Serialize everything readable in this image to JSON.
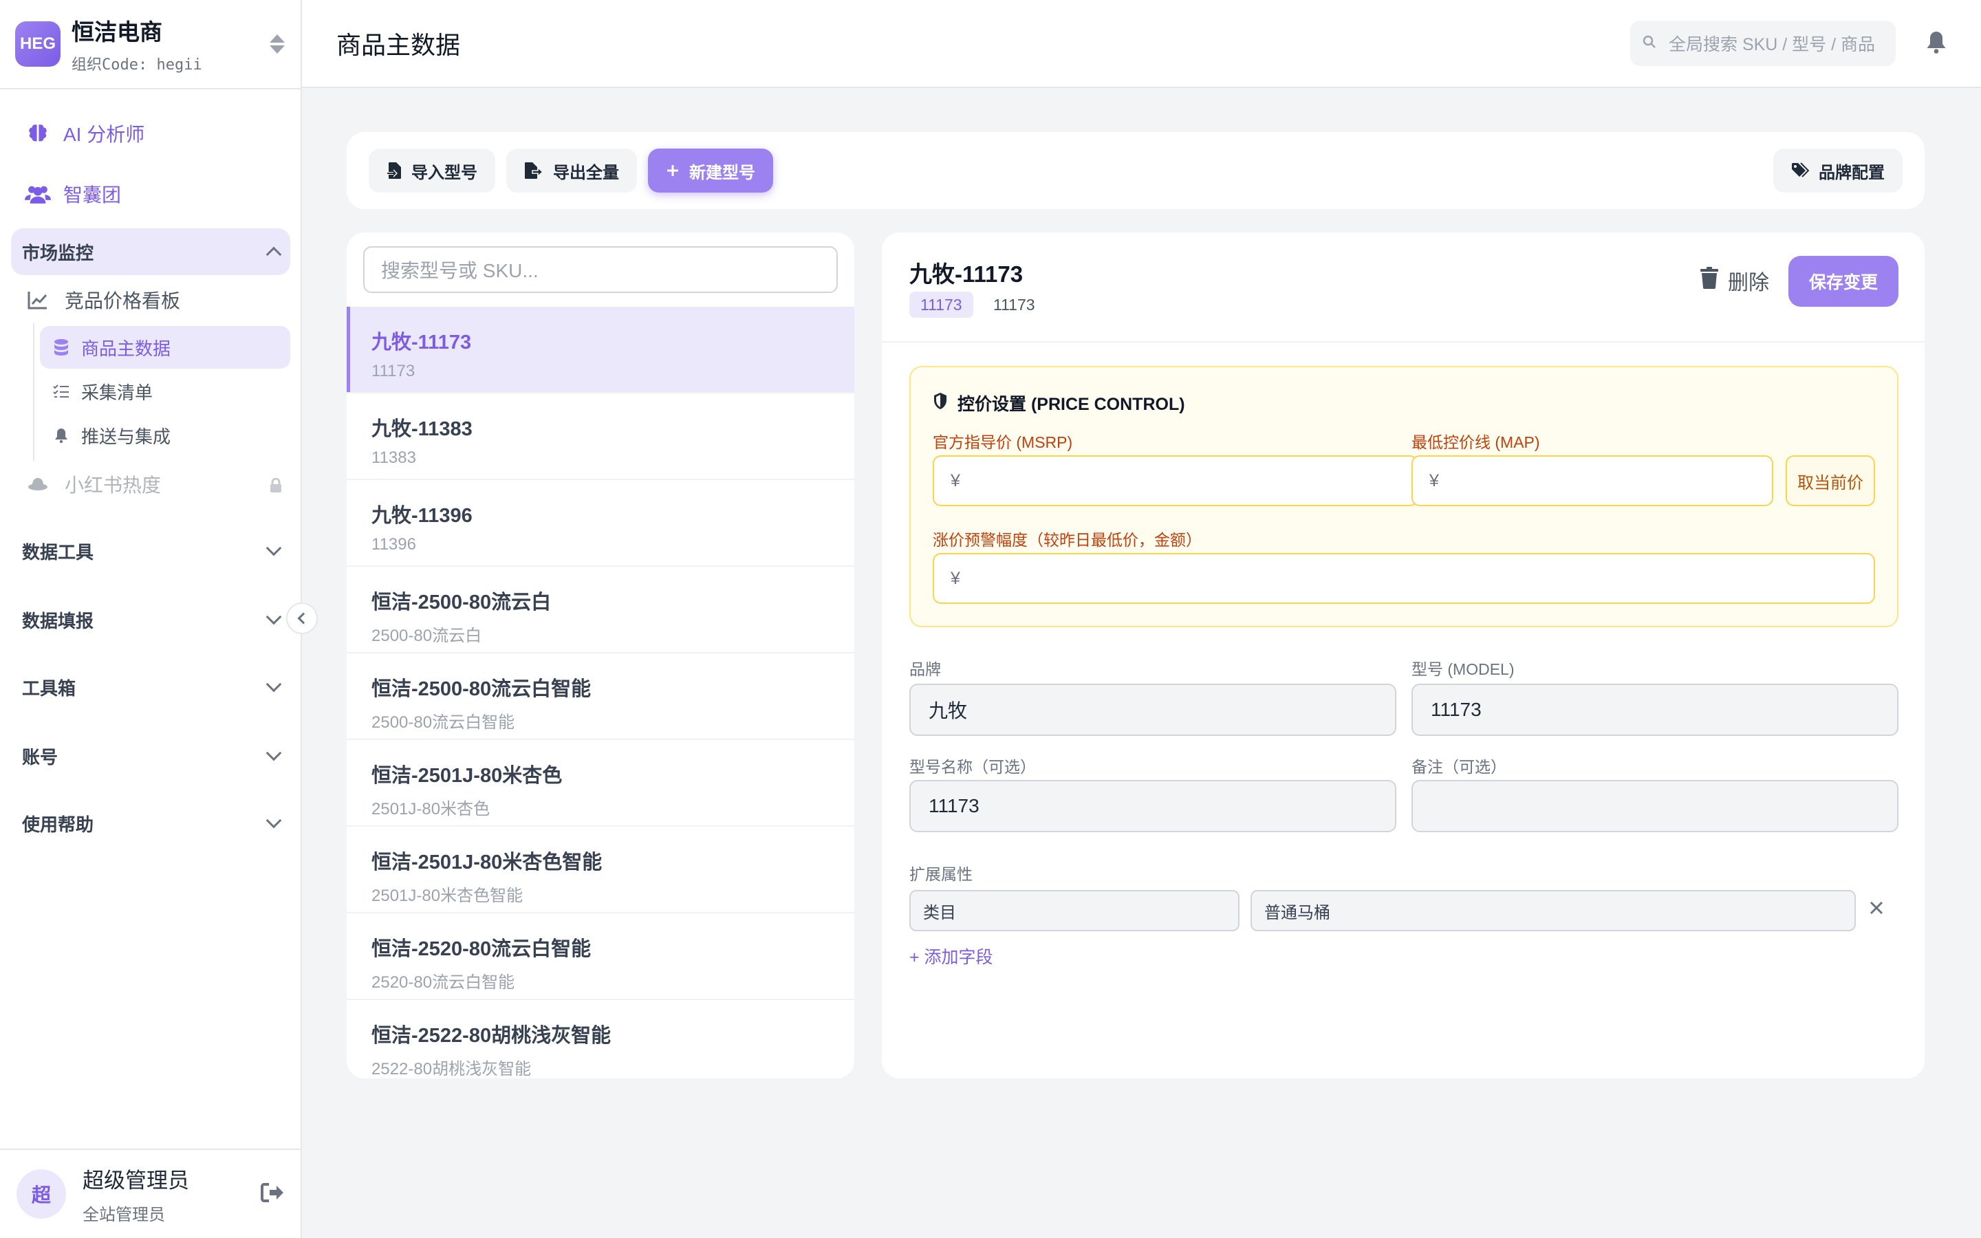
{
  "org": {
    "logo_text": "HEG",
    "name": "恒洁电商",
    "code": "组织Code: hegii"
  },
  "nav": {
    "ai_analyst": "AI 分析师",
    "think_tank": "智囊团",
    "market_group": "市场监控",
    "price_board": "竞品价格看板",
    "product_master": "商品主数据",
    "collect_list": "采集清单",
    "push_integration": "推送与集成",
    "xhs_heat": "小红书热度",
    "groups": [
      "数据工具",
      "数据填报",
      "工具箱",
      "账号",
      "使用帮助"
    ]
  },
  "user": {
    "avatar_text": "超",
    "name": "超级管理员",
    "role": "全站管理员"
  },
  "header": {
    "title": "商品主数据",
    "search_placeholder": "全局搜索 SKU / 型号 / 商品"
  },
  "toolbar": {
    "import": "导入型号",
    "export": "导出全量",
    "new_model": "新建型号",
    "brand_config": "品牌配置"
  },
  "list": {
    "search_placeholder": "搜索型号或 SKU...",
    "items": [
      {
        "name": "九牧-11173",
        "sku": "11173"
      },
      {
        "name": "九牧-11383",
        "sku": "11383"
      },
      {
        "name": "九牧-11396",
        "sku": "11396"
      },
      {
        "name": "恒洁-2500-80流云白",
        "sku": "2500-80流云白"
      },
      {
        "name": "恒洁-2500-80流云白智能",
        "sku": "2500-80流云白智能"
      },
      {
        "name": "恒洁-2501J-80米杏色",
        "sku": "2501J-80米杏色"
      },
      {
        "name": "恒洁-2501J-80米杏色智能",
        "sku": "2501J-80米杏色智能"
      },
      {
        "name": "恒洁-2520-80流云白智能",
        "sku": "2520-80流云白智能"
      },
      {
        "name": "恒洁-2522-80胡桃浅灰智能",
        "sku": "2522-80胡桃浅灰智能"
      }
    ]
  },
  "detail": {
    "title": "九牧-11173",
    "tag": "11173",
    "tag_plain": "11173",
    "delete": "删除",
    "save": "保存变更",
    "price_control": {
      "title": "控价设置 (PRICE CONTROL)",
      "msrp_label": "官方指导价 (MSRP)",
      "msrp_value": "¥",
      "map_label": "最低控价线 (MAP)",
      "map_value": "¥",
      "undercut_button": "取当前价",
      "alert_label": "涨价预警幅度（较昨日最低价，金额）",
      "alert_value": "¥"
    },
    "brand_label": "品牌",
    "brand_value": "九牧",
    "model_label": "型号 (MODEL)",
    "model_value": "11173",
    "model_name_label": "型号名称（可选）",
    "model_name_value": "11173",
    "note_label": "备注（可选）",
    "note_value": "",
    "ext_label": "扩展属性",
    "ext_key": "类目",
    "ext_value": "普通马桶",
    "add_field": "+ 添加字段"
  }
}
